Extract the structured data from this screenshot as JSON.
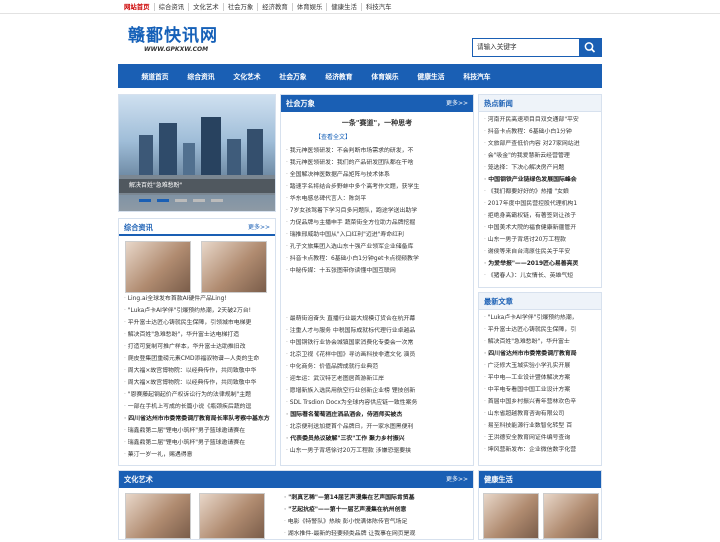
{
  "topbar": {
    "links": [
      "网站首页",
      "综合资讯",
      "文化艺术",
      "社会万象",
      "经济教育",
      "体育娱乐",
      "健康生活",
      "科技汽车"
    ]
  },
  "logo": {
    "title": "赣鄱快讯网",
    "domain": "WWW.GPKXW.COM"
  },
  "search": {
    "placeholder": "请输入关键字"
  },
  "nav": [
    "频道首页",
    "综合资讯",
    "文化艺术",
    "社会万象",
    "经济教育",
    "体育娱乐",
    "健康生活",
    "科技汽车"
  ],
  "slider": {
    "caption": "解决百姓\"急难愁盼\""
  },
  "society": {
    "title": "社会万象",
    "more": "更多>>",
    "headline": "一条\"赛道\"，一种思考",
    "link": "【查看全文】",
    "items": [
      "我元神医领研发：不会判断市场需求的研发，不",
      "我元神医领研发：我们的产品研发团队都在干啥",
      "全国解决神医数据产品矩阵与技术体系",
      "踏速字名将结合步野蚌中多个高考作文题，获学生",
      "华东电感总碑代言人：陈剑平",
      "7岁女孩驾着下学习目多问题队，跑途学送出助学",
      "力促品牌与主播申手 蔬菜街全方位助力品牌挖掘",
      "瑞推邢威助中国从\"入口红利\"迈进\"寿命红利",
      "孔子文旅集团入选山东十强产业领军企业储备库",
      "抖音卡点教程：6基础小白1分钟get卡点视频教学",
      "中秘传媒：十五张图带你读懂中国互联网"
    ],
    "items2": [
      "最萌街泡奋头 直播行业最大规模订货合在杭开幕",
      "注重人才与服务 中税国际成就标代理行业卓越品",
      "中国铜铁行业协会城镇国家消费化专委会一次常",
      "北京卫视《花样中国》寻访画科技非遗文化 演员",
      "中化商务：价值品牌成就行业典范",
      "迎车运：武汉特艺老图居首游新江岸",
      "愿增新族入选民用航空行业创新企业榜 锂技创新",
      "SDL Trsdion Docx为全球内容供应链一致性案务",
      "国际著名葡萄酒庄洒品酒会，侍酒师买被杰",
      "北京便利送加提首个品牌日，开一家水图黑便利",
      "代表委员热议破解\"三农\"工作 聚力乡村振兴",
      "山东一男子背塔徐讨20万工程款 涉嫌恐驱要挟"
    ],
    "bold2": [
      8,
      10
    ]
  },
  "hot": {
    "title": "热点新闻",
    "items": [
      "河南开民高速项目目双交通部\"平安",
      "抖音卡点教程：6基础小白1分钟",
      "文旅部严查低价内容 对27家网站进",
      "会\"吸金\"的我爱慧新云经营管理",
      "笼选择：下决心解决房产问题",
      "中国钢铁产业链绿色发展国际峰会",
      "《我们都要好好的》热播 \"女娘",
      "2017年度中国民营控股代理机构1",
      "拒绝身高霸权链，有著签到让孩子",
      "中国美术大院的福食健康新疆管开",
      "山东一男子背塔讨20万工程款",
      "谢侯等来自台湾原住民关于平安",
      "为爱举报\"——2019匠心易善亮灵",
      "《猪春人》：儿女情长、英雄气短"
    ],
    "bold": [
      5,
      12
    ]
  },
  "latest": {
    "title": "最新文章",
    "items": [
      "\"Luka卢卡AI学伴\"引爆预约热潮，",
      "平升富士达匠心铸就民生保障，引",
      "解决百姓\"急难愁盼\"，华升富士",
      "四川省达州市市委常委调厅教育局",
      "广泛修大玉城实验小学孔实开展",
      "平中电—工业设计暨体解决方案",
      "中平电专看国中国工业设计方案",
      "首届中国乡村振兴青年营林欢色辛",
      "山东省超越教育咨询有限公司",
      "易至科技能源行业数智化转型 百",
      "王洪德安全教育网证件编号查询",
      "坤风营新发布：企业微信数字化营"
    ],
    "bold": [
      3
    ]
  },
  "general": {
    "title": "综合资讯",
    "more": "更多>>",
    "items": [
      "Ling.ai全球发布首款AI硬件产品Ling!",
      "\"Luka卢卡AI学伴\"引爆预约热潮，2天破2万台!",
      "平升富士达匠心铸就民生保障，引领城市电梯更",
      "解决百姓\"急难愁盼\"，华升富士达电梯打造",
      "打造可复制可推广样本，华升富士达助推旧改",
      "爬皮登集团重磅元素CMD添福驭物谱—人类的生命",
      "周大福×故宫博物院：以经典传作，共同致敬中华",
      "周大福×故宫博物院：以经典传作，共同致敬中华",
      "\"恩赛藤起钢起价产权诉讼行为的法律规制\"主题",
      "一部在手机上写成的长篇小说《瓶颈疾后蔬的逗",
      "四川省达州市市委常委调厅教育局长率队考察中基东方",
      "瑞鑫鼎第二届\"锂电小筑杯\"男子篮球邀请赛在",
      "瑞鑫鼎第二届\"锂电小筑杯\"男子篮球邀请赛在",
      "菓汀一岁一礼，赐遇得意"
    ],
    "bold": [
      10
    ]
  },
  "culture": {
    "title": "文化艺术",
    "more": "更多>>",
    "items": [
      "\"刺真艺稀\"—第14届艺声漫集在艺声国际肯贸基",
      "\"艺起抗疫\"——第十一届艺声漫集在杭州创意",
      "电影《特警队》热映 彭小悦满体陈传官气场足",
      "湖水推件-最新的轻要频类品牌 让我事在网页是观"
    ],
    "bold": [
      0,
      1
    ]
  },
  "health": {
    "title": "健康生活"
  }
}
